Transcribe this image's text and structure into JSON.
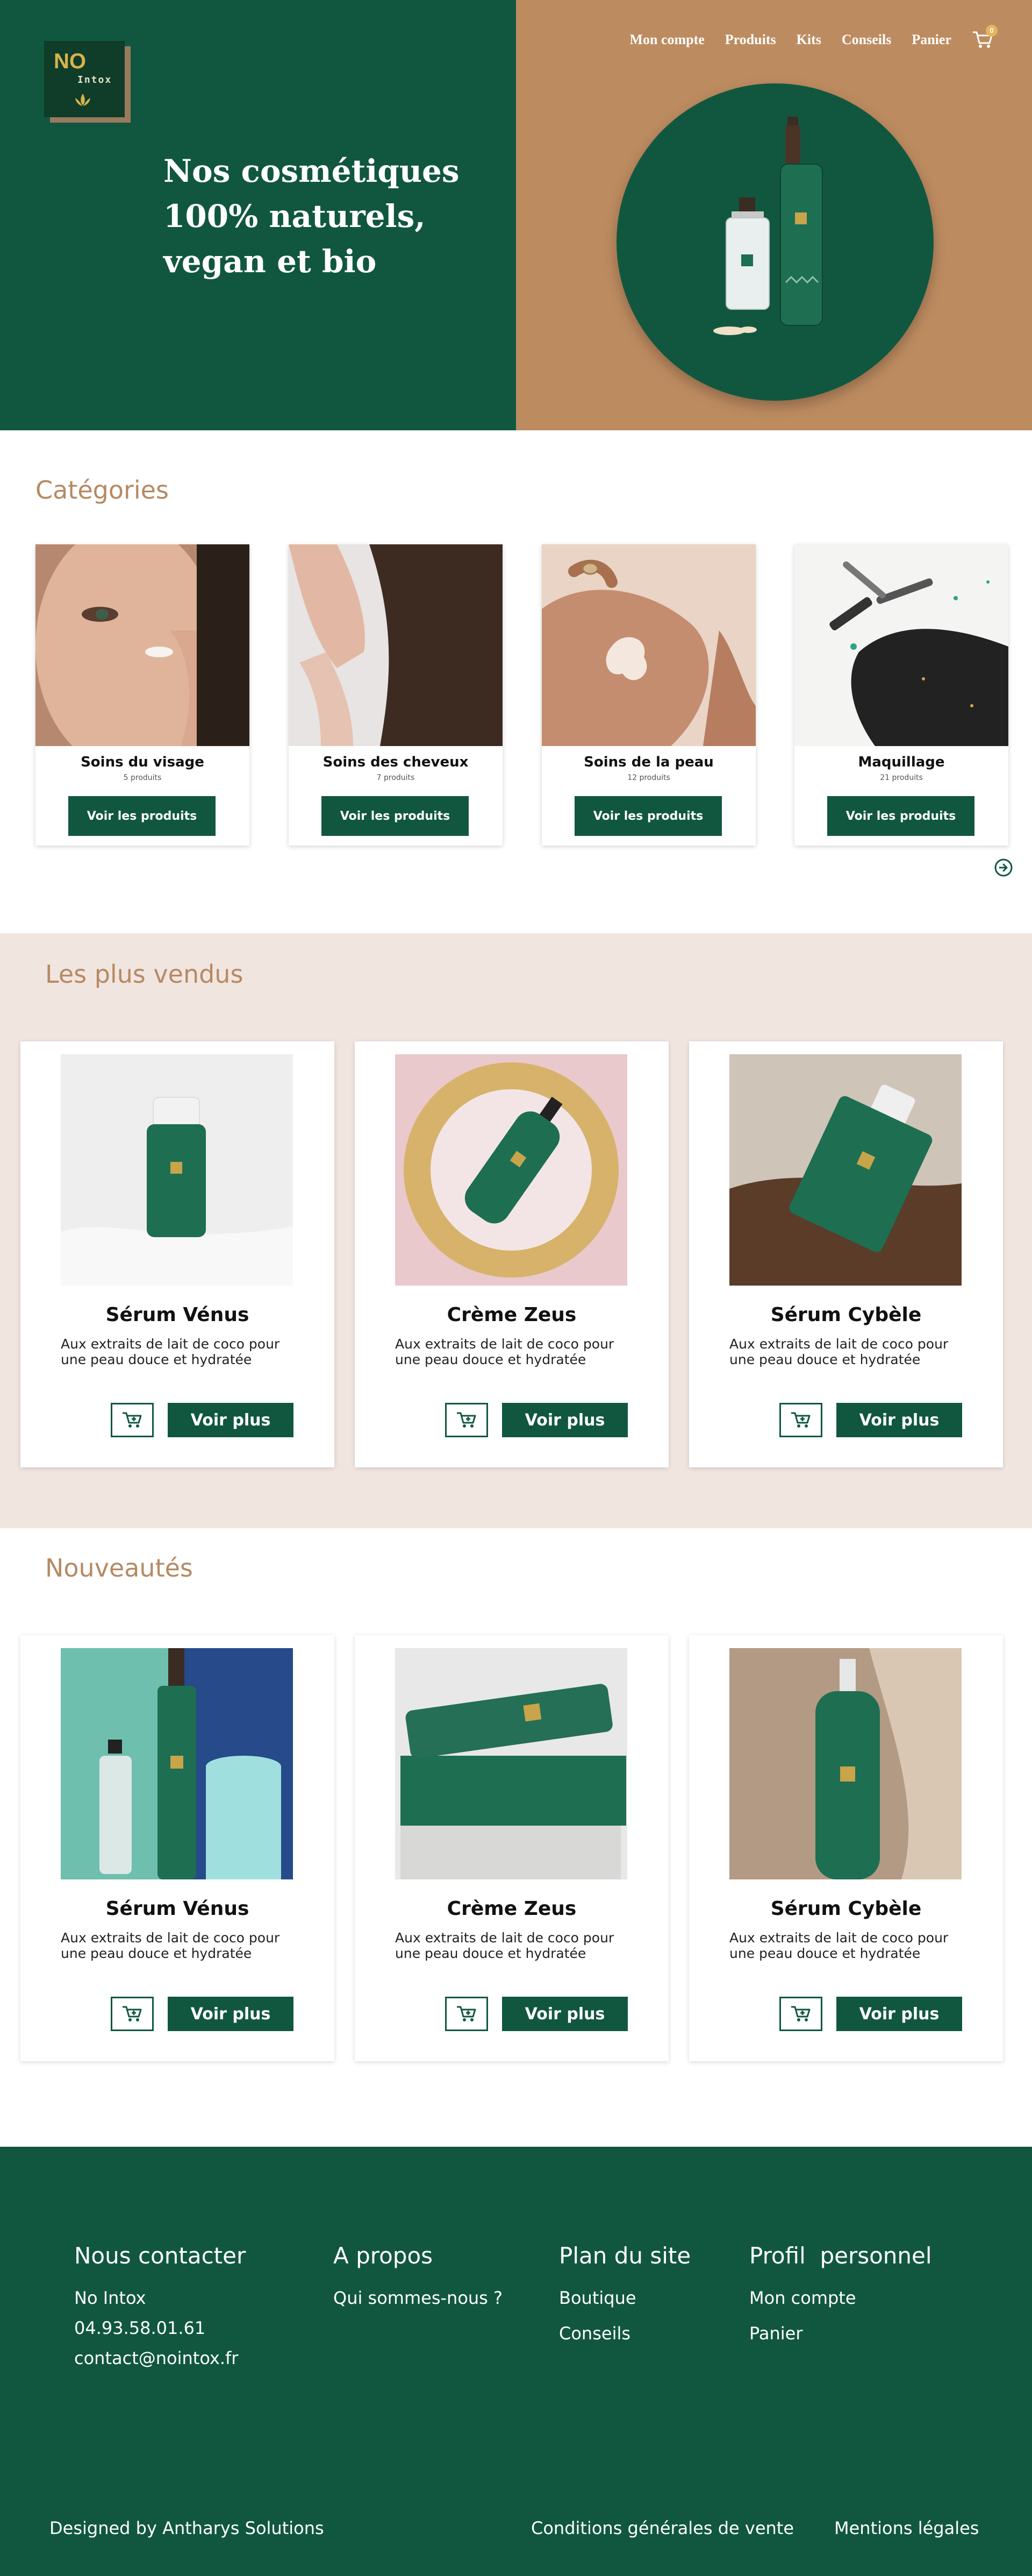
{
  "logo": {
    "no": "NO",
    "intox": "Intox"
  },
  "hero": {
    "title": "Nos cosmétiques 100% naturels, vegan et bio"
  },
  "nav": {
    "items": [
      "Mon compte",
      "Produits",
      "Kits",
      "Conseils",
      "Panier"
    ],
    "cart_count": "0"
  },
  "colors": {
    "primary": "#115740",
    "accent": "#bd8b60",
    "title": "#b68a63",
    "band": "#f1e5e0"
  },
  "categories": {
    "title": "Catégories",
    "button_label": "Voir les produits",
    "items": [
      {
        "name": "Soins du visage",
        "count": "5 produits"
      },
      {
        "name": "Soins des cheveux",
        "count": "7 produits"
      },
      {
        "name": "Soins de la peau",
        "count": "12 produits"
      },
      {
        "name": "Maquillage",
        "count": "21 produits"
      }
    ]
  },
  "bestsellers": {
    "title": "Les plus vendus",
    "button_label": "Voir plus",
    "items": [
      {
        "name": "Sérum Vénus",
        "desc": "Aux extraits de lait de coco pour une peau douce et hydratée"
      },
      {
        "name": "Crème Zeus",
        "desc": "Aux extraits de lait de coco pour une peau douce et hydratée"
      },
      {
        "name": "Sérum Cybèle",
        "desc": "Aux extraits de lait de coco pour une peau douce et hydratée"
      }
    ]
  },
  "new": {
    "title": "Nouveautés",
    "button_label": "Voir plus",
    "items": [
      {
        "name": "Sérum Vénus",
        "desc": "Aux extraits de lait de coco pour une peau douce et hydratée"
      },
      {
        "name": "Crème Zeus",
        "desc": "Aux extraits de lait de coco pour une peau douce et hydratée"
      },
      {
        "name": "Sérum Cybèle",
        "desc": "Aux extraits de lait de coco pour une peau douce et hydratée"
      }
    ]
  },
  "footer": {
    "contact": {
      "title": "Nous contacter",
      "name": "No Intox",
      "phone": "04.93.58.01.61",
      "email": "contact@nointox.fr"
    },
    "about": {
      "title": "A propos",
      "link": "Qui sommes-nous ?"
    },
    "sitemap": {
      "title": "Plan du site",
      "links": [
        "Boutique",
        "Conseils"
      ]
    },
    "profile": {
      "title": "Profil  personnel",
      "links": [
        "Mon compte",
        "Panier"
      ]
    },
    "credit": "Designed by Antharys Solutions",
    "cgv": "Conditions générales de vente",
    "legal": "Mentions légales"
  }
}
